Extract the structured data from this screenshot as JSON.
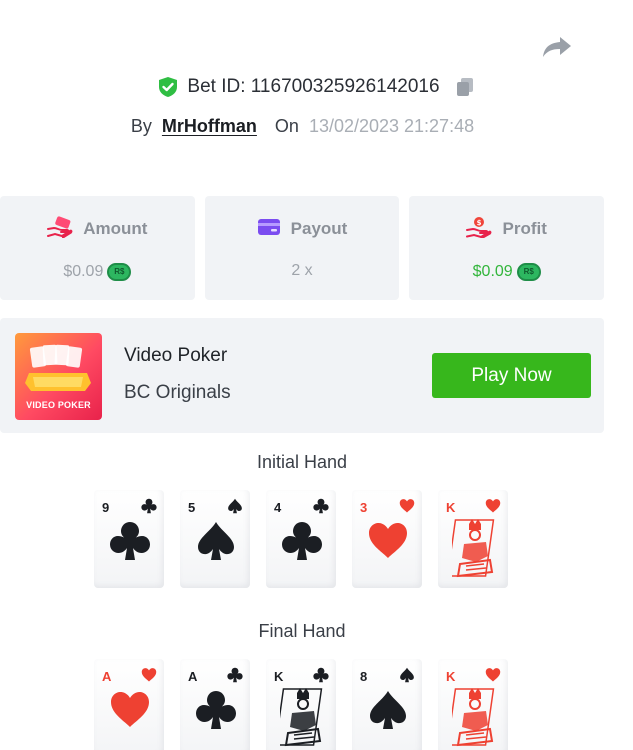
{
  "bet": {
    "id_label": "Bet ID: 116700325926142016",
    "by_label": "By",
    "user": "MrHoffman",
    "on_label": "On",
    "date": "13/02/2023 21:27:48"
  },
  "stats": [
    {
      "title": "Amount",
      "value": "$0.09",
      "coin": "R$"
    },
    {
      "title": "Payout",
      "value": "2 x"
    },
    {
      "title": "Profit",
      "value": "$0.09",
      "coin": "R$"
    }
  ],
  "game": {
    "name": "Video Poker",
    "provider": "BC Originals",
    "thumb_label": "VIDEO POKER",
    "play_label": "Play Now"
  },
  "initial_hand": {
    "title": "Initial Hand",
    "cards": [
      {
        "rank": "9",
        "suit": "clubs"
      },
      {
        "rank": "5",
        "suit": "spades"
      },
      {
        "rank": "4",
        "suit": "clubs"
      },
      {
        "rank": "3",
        "suit": "hearts"
      },
      {
        "rank": "K",
        "suit": "hearts"
      }
    ]
  },
  "final_hand": {
    "title": "Final Hand",
    "cards": [
      {
        "rank": "A",
        "suit": "hearts"
      },
      {
        "rank": "A",
        "suit": "clubs"
      },
      {
        "rank": "K",
        "suit": "clubs"
      },
      {
        "rank": "8",
        "suit": "spades"
      },
      {
        "rank": "K",
        "suit": "hearts"
      }
    ]
  },
  "colors": {
    "green": "#37b71c",
    "red_suit": "#ee4132",
    "black_suit": "#1b1e23",
    "panel": "#f1f3f6"
  },
  "icons": {
    "share": "share-icon",
    "verified": "shield-check-icon",
    "copy": "copy-icon",
    "amount": "money-hand-icon",
    "payout": "card-icon",
    "profit": "profit-hand-icon"
  }
}
